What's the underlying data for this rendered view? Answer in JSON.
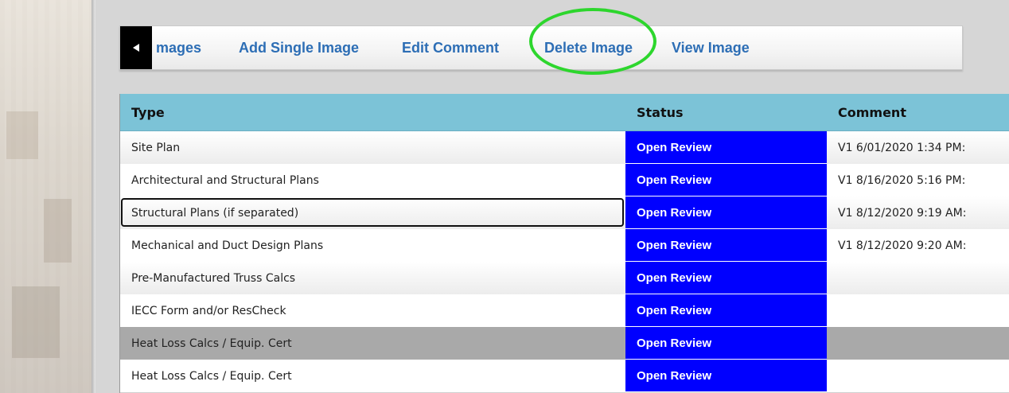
{
  "toolbar": {
    "back_icon": "caret-left-icon",
    "links": [
      "mages",
      "Add Single Image",
      "Edit Comment",
      "Delete Image",
      "View Image"
    ],
    "highlight_color": "#2dd62d"
  },
  "table": {
    "columns": [
      "Type",
      "Status",
      "Comment"
    ],
    "header_color": "#7cc3d7",
    "status_color": "#0000ff",
    "rows": [
      {
        "type": "Site Plan",
        "status": "Open Review",
        "comment": "V1 6/01/2020 1:34 PM:"
      },
      {
        "type": "Architectural and Structural Plans",
        "status": "Open Review",
        "comment": "V1 8/16/2020 5:16 PM:"
      },
      {
        "type": "Structural Plans (if separated)",
        "status": "Open Review",
        "comment": "V1 8/12/2020 9:19 AM:"
      },
      {
        "type": "Mechanical and Duct Design Plans",
        "status": "Open Review",
        "comment": "V1 8/12/2020 9:20 AM:"
      },
      {
        "type": "Pre-Manufactured Truss Calcs",
        "status": "Open Review",
        "comment": ""
      },
      {
        "type": "IECC Form and/or ResCheck",
        "status": "Open Review",
        "comment": ""
      },
      {
        "type": "Heat Loss Calcs / Equip. Cert",
        "status": "Open Review",
        "comment": ""
      },
      {
        "type": "Heat Loss Calcs / Equip. Cert",
        "status": "Open Review",
        "comment": ""
      }
    ]
  }
}
